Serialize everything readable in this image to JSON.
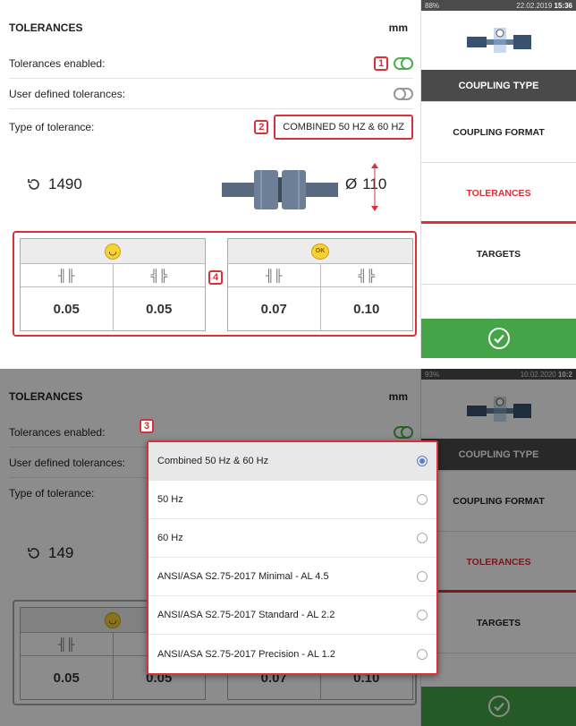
{
  "screen1": {
    "status": {
      "battery": "88%",
      "datetime": "22.02.2019",
      "time": "15:36"
    },
    "header": {
      "title": "TOLERANCES",
      "unit": "mm"
    },
    "rows": {
      "enabled_label": "Tolerances enabled:",
      "user_defined_label": "User defined tolerances:",
      "type_label": "Type of tolerance:",
      "type_value": "COMBINED 50 HZ & 60 HZ"
    },
    "markers": {
      "m1": "1",
      "m2": "2",
      "m4": "4"
    },
    "rpm": "1490",
    "diameter_symbol": "Ø",
    "diameter": "110",
    "tables": {
      "excellent": {
        "values": [
          "0.05",
          "0.05"
        ]
      },
      "acceptable": {
        "badge": "OK",
        "values": [
          "0.07",
          "0.10"
        ]
      }
    },
    "sidebar": [
      "COUPLING TYPE",
      "COUPLING FORMAT",
      "TOLERANCES",
      "TARGETS"
    ]
  },
  "screen2": {
    "status": {
      "battery": "93%",
      "datetime": "10.02.2020",
      "time": "10:2"
    },
    "header": {
      "title": "TOLERANCES",
      "unit": "mm"
    },
    "rows": {
      "enabled_label": "Tolerances enabled:",
      "user_defined_label": "User defined tolerances:",
      "type_label": "Type of tolerance:"
    },
    "marker": "3",
    "rpm_partial": "149",
    "tables": {
      "excellent": {
        "values": [
          "0.05",
          "0.05"
        ]
      },
      "acceptable": {
        "values": [
          "0.07",
          "0.10"
        ]
      }
    },
    "sidebar": [
      "COUPLING TYPE",
      "COUPLING FORMAT",
      "TOLERANCES",
      "TARGETS"
    ],
    "options": [
      "Combined 50 Hz & 60 Hz",
      "50 Hz",
      "60 Hz",
      "ANSI/ASA S2.75-2017 Minimal - AL 4.5",
      "ANSI/ASA S2.75-2017 Standard - AL 2.2",
      "ANSI/ASA S2.75-2017 Precision - AL 1.2"
    ],
    "selected_index": 0
  },
  "colors": {
    "accent_red": "#d9303a",
    "ok_green": "#44a447",
    "toggle_green": "#4caf50",
    "dark_header": "#4a4a4a"
  }
}
